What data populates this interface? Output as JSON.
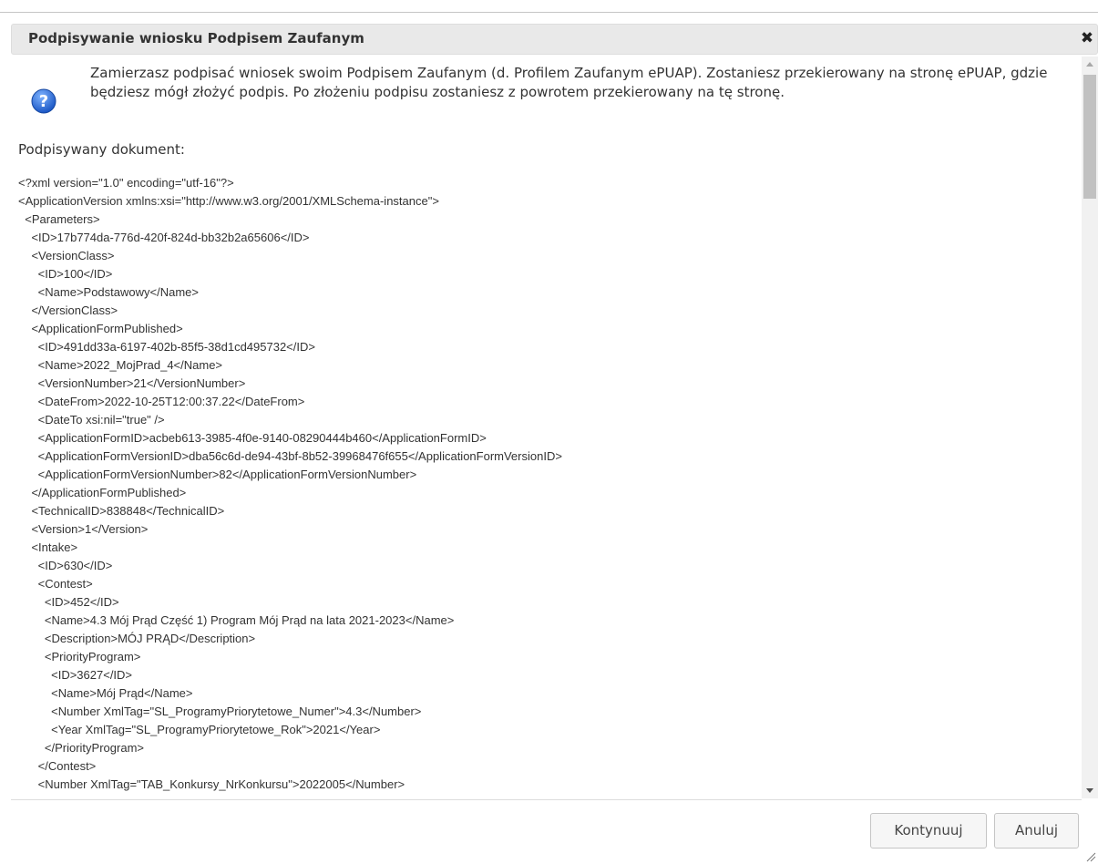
{
  "dialog": {
    "title": "Podpisywanie wniosku Podpisem Zaufanym",
    "close_symbol": "✖",
    "message": "Zamierzasz podpisać wniosek swoim Podpisem Zaufanym (d. Profilem Zaufanym ePUAP). Zostaniesz przekierowany na stronę ePUAP, gdzie będziesz mógł złożyć podpis. Po złożeniu podpisu zostaniesz z powrotem przekierowany na tę stronę.",
    "message_icon": "question-icon",
    "document_label": "Podpisywany dokument:",
    "xml_lines": [
      "<?xml version=\"1.0\" encoding=\"utf-16\"?>",
      "<ApplicationVersion xmlns:xsi=\"http://www.w3.org/2001/XMLSchema-instance\">",
      "  <Parameters>",
      "    <ID>17b774da-776d-420f-824d-bb32b2a65606</ID>",
      "    <VersionClass>",
      "      <ID>100</ID>",
      "      <Name>Podstawowy</Name>",
      "    </VersionClass>",
      "    <ApplicationFormPublished>",
      "      <ID>491dd33a-6197-402b-85f5-38d1cd495732</ID>",
      "      <Name>2022_MojPrad_4</Name>",
      "      <VersionNumber>21</VersionNumber>",
      "      <DateFrom>2022-10-25T12:00:37.22</DateFrom>",
      "      <DateTo xsi:nil=\"true\" />",
      "      <ApplicationFormID>acbeb613-3985-4f0e-9140-08290444b460</ApplicationFormID>",
      "      <ApplicationFormVersionID>dba56c6d-de94-43bf-8b52-39968476f655</ApplicationFormVersionID>",
      "      <ApplicationFormVersionNumber>82</ApplicationFormVersionNumber>",
      "    </ApplicationFormPublished>",
      "    <TechnicalID>838848</TechnicalID>",
      "    <Version>1</Version>",
      "    <Intake>",
      "      <ID>630</ID>",
      "      <Contest>",
      "        <ID>452</ID>",
      "        <Name>4.3 Mój Prąd Część 1) Program Mój Prąd na lata 2021-2023</Name>",
      "        <Description>MÓJ PRĄD</Description>",
      "        <PriorityProgram>",
      "          <ID>3627</ID>",
      "          <Name>Mój Prąd</Name>",
      "          <Number XmlTag=\"SL_ProgramyPriorytetowe_Numer\">4.3</Number>",
      "          <Year XmlTag=\"SL_ProgramyPriorytetowe_Rok\">2021</Year>",
      "        </PriorityProgram>",
      "      </Contest>",
      "      <Number XmlTag=\"TAB_Konkursy_NrKonkursu\">2022005</Number>"
    ]
  },
  "buttons": {
    "continue_label": "Kontynuuj",
    "cancel_label": "Anuluj"
  },
  "colors": {
    "titlebar_bg": "#e9e9e9",
    "icon_blue": "#2b6fd1",
    "text": "#333333"
  }
}
